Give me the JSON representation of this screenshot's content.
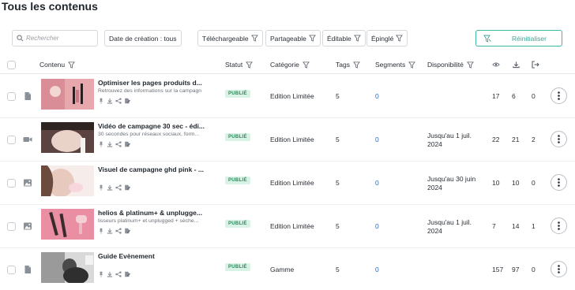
{
  "page": {
    "title": "Tous les contenus"
  },
  "filters": {
    "search_placeholder": "Rechercher",
    "creation_date": "Date de création : tous",
    "downloadable": "Téléchargeable",
    "shareable": "Partageable",
    "editable": "Éditable",
    "pinned": "Épinglé",
    "reset": "Réinitialiser"
  },
  "columns": {
    "content": "Contenu",
    "status": "Statut",
    "category": "Catégorie",
    "tags": "Tags",
    "segments": "Segments",
    "availability": "Disponibilité"
  },
  "colors": {
    "accent": "#3fb9a4",
    "badge_bg": "#d9f2e6",
    "badge_text": "#2b8a5a",
    "link": "#2a6ab8"
  },
  "rows": [
    {
      "type_icon": "document-icon",
      "title": "Optimiser les pages produits d...",
      "description": "Retrouvez des informations sur la campagn",
      "status": "PUBLIÉ",
      "category": "Edition Limitée",
      "tags": "5",
      "segments": "0",
      "availability_1": "",
      "availability_2": "",
      "views": "17",
      "downloads": "6",
      "shares": "0"
    },
    {
      "type_icon": "video-icon",
      "title": "Vidéo de campagne 30 sec - édi...",
      "description": "30 secondes pour réseaux sociaux, form...",
      "status": "PUBLIÉ",
      "category": "Edition Limitée",
      "tags": "5",
      "segments": "0",
      "availability_1": "Jusqu'au 1 juil.",
      "availability_2": "2024",
      "views": "22",
      "downloads": "21",
      "shares": "2"
    },
    {
      "type_icon": "image-icon",
      "title": "Visuel de campagne ghd pink - ...",
      "description": "",
      "status": "PUBLIÉ",
      "category": "Edition Limitée",
      "tags": "5",
      "segments": "0",
      "availability_1": "Jusqu'au 30 juin",
      "availability_2": "2024",
      "views": "10",
      "downloads": "10",
      "shares": "0"
    },
    {
      "type_icon": "image-icon",
      "title": "helios & platinum+ & unplugge...",
      "description": "lisseurs platinum+ et unplugged + sèche...",
      "status": "PUBLIÉ",
      "category": "Edition Limitée",
      "tags": "5",
      "segments": "0",
      "availability_1": "Jusqu'au 1 juil.",
      "availability_2": "2024",
      "views": "7",
      "downloads": "14",
      "shares": "1"
    },
    {
      "type_icon": "document-icon",
      "title": "Guide Evènement",
      "description": "",
      "status": "PUBLIÉ",
      "category": "Gamme",
      "tags": "5",
      "segments": "0",
      "availability_1": "",
      "availability_2": "",
      "views": "157",
      "downloads": "97",
      "shares": "0"
    }
  ]
}
